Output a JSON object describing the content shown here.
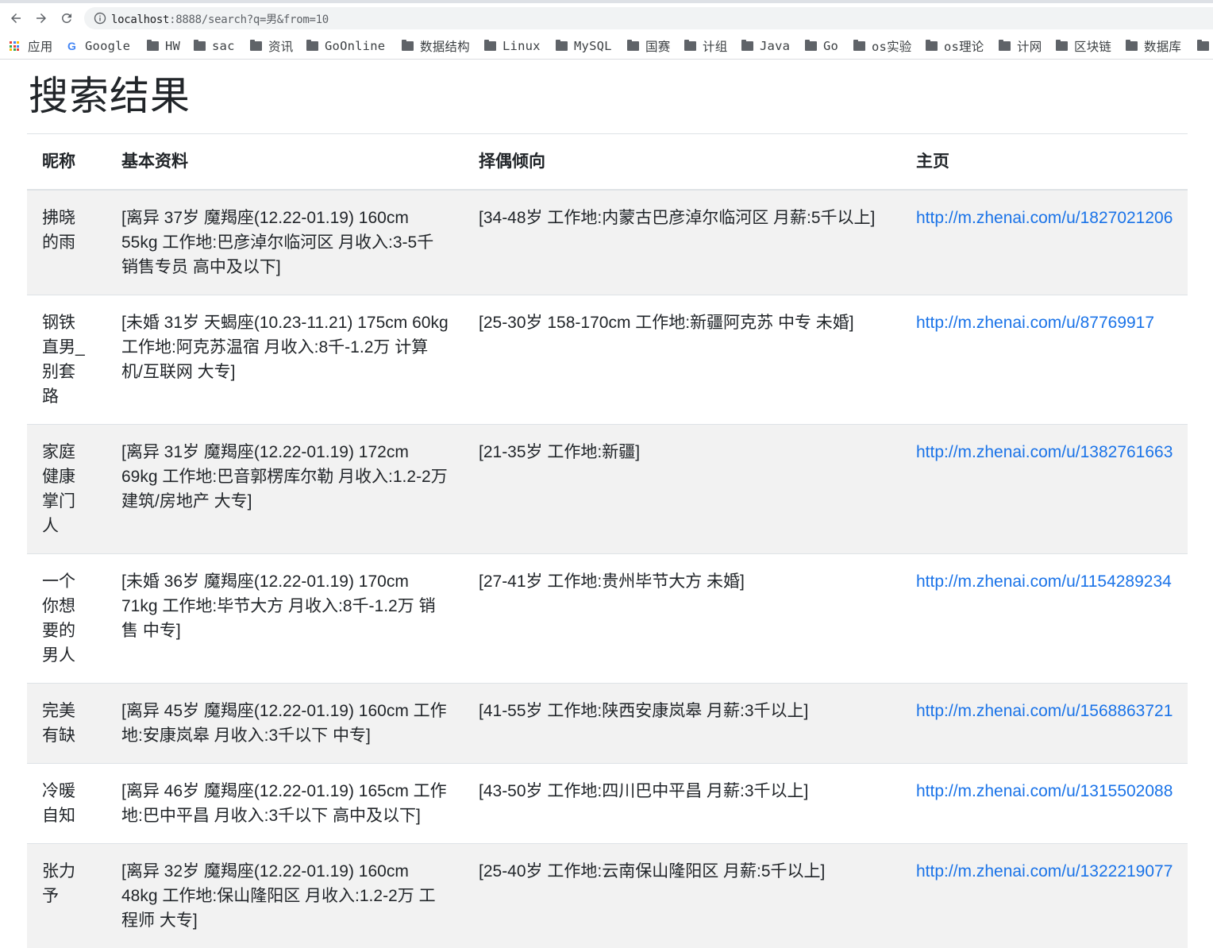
{
  "browser": {
    "url_host": "localhost",
    "url_rest": ":8888/search?q=男&from=10",
    "bookmarks": [
      {
        "label": "应用",
        "icon": "apps-icon"
      },
      {
        "label": "Google",
        "icon": "google-icon"
      },
      {
        "label": "HW",
        "icon": "folder-icon"
      },
      {
        "label": "sac",
        "icon": "folder-icon"
      },
      {
        "label": "资讯",
        "icon": "folder-icon"
      },
      {
        "label": "GoOnline",
        "icon": "folder-icon"
      },
      {
        "label": "数据结构",
        "icon": "folder-icon"
      },
      {
        "label": "Linux",
        "icon": "folder-icon"
      },
      {
        "label": "MySQL",
        "icon": "folder-icon"
      },
      {
        "label": "国赛",
        "icon": "folder-icon"
      },
      {
        "label": "计组",
        "icon": "folder-icon"
      },
      {
        "label": "Java",
        "icon": "folder-icon"
      },
      {
        "label": "Go",
        "icon": "folder-icon"
      },
      {
        "label": "os实验",
        "icon": "folder-icon"
      },
      {
        "label": "os理论",
        "icon": "folder-icon"
      },
      {
        "label": "计网",
        "icon": "folder-icon"
      },
      {
        "label": "区块链",
        "icon": "folder-icon"
      },
      {
        "label": "数据库",
        "icon": "folder-icon"
      }
    ]
  },
  "page": {
    "title": "搜索结果",
    "headers": [
      "昵称",
      "基本资料",
      "择偶倾向",
      "主页"
    ],
    "rows": [
      {
        "nickname": "拂晓的雨",
        "profile": "[离异 37岁 魔羯座(12.22-01.19) 160cm 55kg 工作地:巴彦淖尔临河区 月收入:3-5千 销售专员 高中及以下]",
        "preference": "[34-48岁 工作地:内蒙古巴彦淖尔临河区 月薪:5千以上]",
        "url": "http://m.zhenai.com/u/1827021206"
      },
      {
        "nickname": "钢铁直男_别套路",
        "profile": "[未婚 31岁 天蝎座(10.23-11.21) 175cm 60kg 工作地:阿克苏温宿 月收入:8千-1.2万 计算机/互联网 大专]",
        "preference": "[25-30岁 158-170cm 工作地:新疆阿克苏 中专 未婚]",
        "url": "http://m.zhenai.com/u/87769917"
      },
      {
        "nickname": "家庭健康掌门人",
        "profile": "[离异 31岁 魔羯座(12.22-01.19) 172cm 69kg 工作地:巴音郭楞库尔勒 月收入:1.2-2万 建筑/房地产 大专]",
        "preference": "[21-35岁 工作地:新疆]",
        "url": "http://m.zhenai.com/u/1382761663"
      },
      {
        "nickname": "一个你想要的男人",
        "profile": "[未婚 36岁 魔羯座(12.22-01.19) 170cm 71kg 工作地:毕节大方 月收入:8千-1.2万 销售 中专]",
        "preference": "[27-41岁 工作地:贵州毕节大方 未婚]",
        "url": "http://m.zhenai.com/u/1154289234"
      },
      {
        "nickname": "完美有缺",
        "profile": "[离异 45岁 魔羯座(12.22-01.19) 160cm 工作地:安康岚皋 月收入:3千以下 中专]",
        "preference": "[41-55岁 工作地:陕西安康岚皋 月薪:3千以上]",
        "url": "http://m.zhenai.com/u/1568863721"
      },
      {
        "nickname": "冷暖自知",
        "profile": "[离异 46岁 魔羯座(12.22-01.19) 165cm 工作地:巴中平昌 月收入:3千以下 高中及以下]",
        "preference": "[43-50岁 工作地:四川巴中平昌 月薪:3千以上]",
        "url": "http://m.zhenai.com/u/1315502088"
      },
      {
        "nickname": "张力予",
        "profile": "[离异 32岁 魔羯座(12.22-01.19) 160cm 48kg 工作地:保山隆阳区 月收入:1.2-2万 工程师 大专]",
        "preference": "[25-40岁 工作地:云南保山隆阳区 月薪:5千以上]",
        "url": "http://m.zhenai.com/u/1322219077"
      }
    ]
  }
}
